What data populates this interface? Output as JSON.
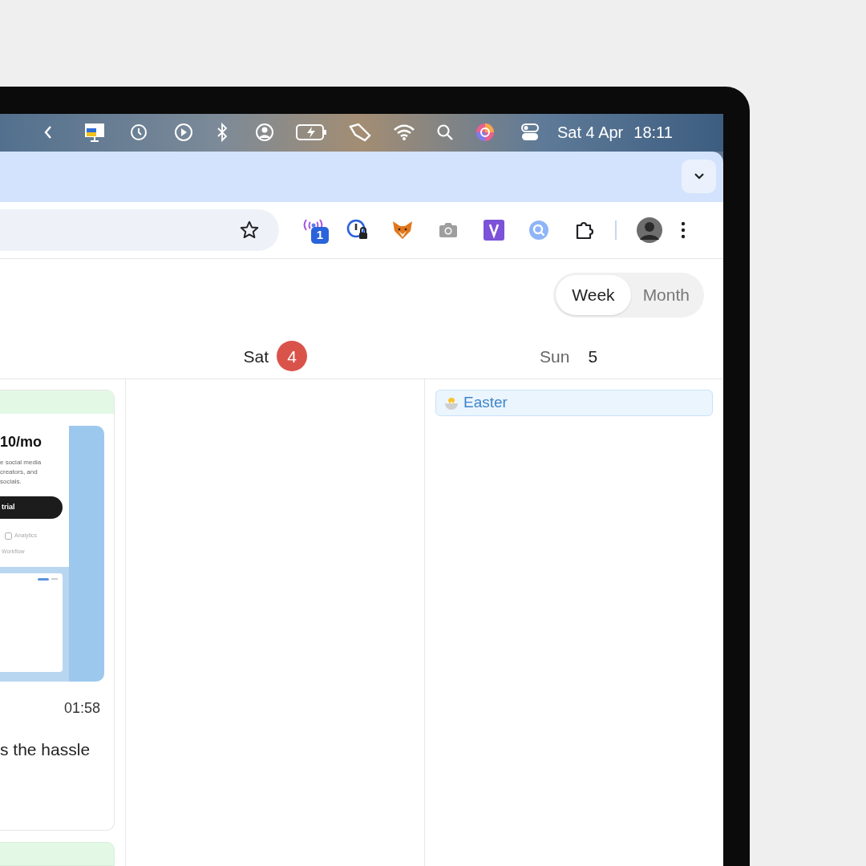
{
  "menu_bar": {
    "date": "Sat 4 Apr",
    "time": "18:11"
  },
  "toolbar": {
    "extension_badge": "1"
  },
  "calendar": {
    "view_toggle": [
      {
        "label": "Week",
        "selected": true
      },
      {
        "label": "Month",
        "selected": false
      }
    ],
    "days": [
      {
        "weekday": "Sat",
        "date": "4",
        "today": true
      },
      {
        "weekday": "Sun",
        "date": "5",
        "today": false,
        "events": [
          {
            "title": "Easter"
          }
        ]
      }
    ],
    "post_card": {
      "thumbnail": {
        "price": "10/mo",
        "lines": [
          "e social media",
          "creators, and",
          "socials."
        ],
        "button": "trial",
        "features": [
          "Analytics",
          "Workflow"
        ]
      },
      "duration": "01:58",
      "caption": "s the hassle"
    }
  }
}
